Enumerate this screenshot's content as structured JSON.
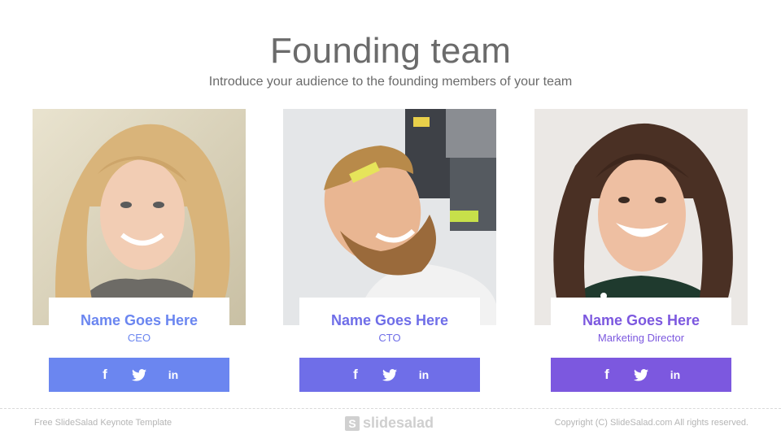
{
  "slide": {
    "title": "Founding team",
    "subtitle": "Introduce your audience to the founding members of your team"
  },
  "team": [
    {
      "name": "Name Goes Here",
      "role": "CEO",
      "accent": "#6b86f0",
      "name_color": "#6b86f0"
    },
    {
      "name": "Name Goes Here",
      "role": "CTO",
      "accent": "#6f6ee8",
      "name_color": "#6f6ee8"
    },
    {
      "name": "Name Goes Here",
      "role": "Marketing Director",
      "accent": "#7c58df",
      "name_color": "#7c58df"
    }
  ],
  "social_icons": [
    "facebook-icon",
    "twitter-icon",
    "linkedin-icon"
  ],
  "social_glyphs": {
    "facebook": "f",
    "linkedin": "in"
  },
  "footer": {
    "left": "Free SlideSalad Keynote Template",
    "logo": "slidesalad",
    "logo_mark": "S",
    "right": "Copyright (C) SlideSalad.com All rights reserved."
  }
}
